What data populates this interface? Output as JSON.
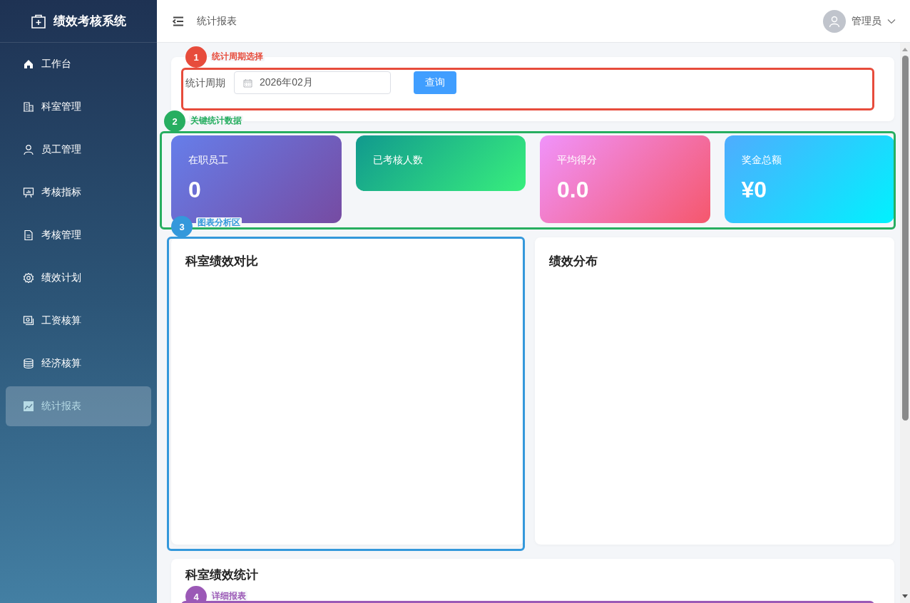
{
  "sidebar": {
    "title": "绩效考核系统",
    "items": [
      {
        "label": "工作台",
        "selected": false
      },
      {
        "label": "科室管理",
        "selected": false
      },
      {
        "label": "员工管理",
        "selected": false
      },
      {
        "label": "考核指标",
        "selected": false
      },
      {
        "label": "考核管理",
        "selected": false
      },
      {
        "label": "绩效计划",
        "selected": false
      },
      {
        "label": "工资核算",
        "selected": false
      },
      {
        "label": "经济核算",
        "selected": false
      },
      {
        "label": "统计报表",
        "selected": true
      }
    ]
  },
  "header": {
    "breadcrumb": "统计报表",
    "user": "管理员"
  },
  "filter": {
    "label": "统计周期",
    "value": "2026年02月",
    "button": "查询"
  },
  "stats": [
    {
      "label": "在职员工",
      "value": "0",
      "kind": "staff"
    },
    {
      "label": "已考核人数",
      "kind": "assessed"
    },
    {
      "label": "平均得分",
      "value": "0.0",
      "kind": "score"
    },
    {
      "label": "奖金总额",
      "value": "¥0",
      "kind": "bonus"
    }
  ],
  "charts": [
    {
      "title": "科室绩效对比"
    },
    {
      "title": "绩效分布"
    }
  ],
  "table_card": {
    "title": "科室绩效统计"
  },
  "annotations": [
    {
      "number": "1",
      "label": "统计周期选择",
      "color": "#e74c3c"
    },
    {
      "number": "2",
      "label": "关键统计数据",
      "color": "#27ae60"
    },
    {
      "number": "3",
      "label": "图表分析区",
      "color": "#3498db"
    },
    {
      "number": "4",
      "label": "详细报表",
      "color": "#9b59b6"
    }
  ]
}
